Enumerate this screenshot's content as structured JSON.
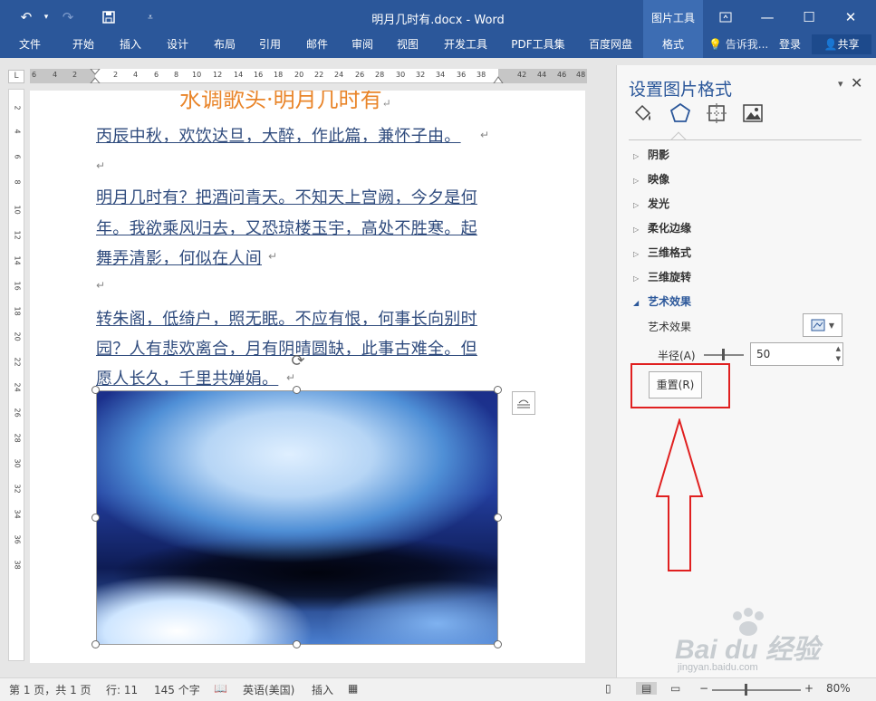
{
  "window": {
    "title": "明月几时有.docx - Word",
    "picture_tools": "图片工具",
    "accent": "#2b579a"
  },
  "ribbon": {
    "tabs": [
      "文件",
      "开始",
      "插入",
      "设计",
      "布局",
      "引用",
      "邮件",
      "审阅",
      "视图",
      "开发工具",
      "PDF工具集",
      "百度网盘",
      "格式"
    ],
    "tellme": "告诉我...",
    "login": "登录",
    "share": "共享"
  },
  "ruler": {
    "corner": "L",
    "h_ticks": [
      "6",
      "4",
      "2",
      "2",
      "4",
      "6",
      "8",
      "10",
      "12",
      "14",
      "16",
      "18",
      "20",
      "22",
      "24",
      "26",
      "28",
      "30",
      "32",
      "34",
      "36",
      "38",
      "42",
      "44",
      "46",
      "48"
    ],
    "v_ticks": [
      "2",
      "4",
      "6",
      "8",
      "10",
      "12",
      "14",
      "16",
      "18",
      "20",
      "22",
      "24",
      "26",
      "28",
      "30",
      "32",
      "34",
      "36",
      "38"
    ]
  },
  "document": {
    "heading": "水调歌头·明月几时有",
    "lines": [
      "丙辰中秋，欢饮达旦，大醉，作此篇，兼怀子由。",
      "明月几时有？把酒问青天。不知天上宫阙，今夕是何",
      "年。我欲乘风归去，又恐琼楼玉宇，高处不胜寒。起",
      "舞弄清影，何似在人间",
      "转朱阁，低绮户，照无眠。不应有恨，何事长向别时",
      "园？人有悲欢离合，月有阴晴圆缺，此事古难全。但",
      "愿人长久，千里共婵娟。"
    ],
    "paragraph_mark": "↵"
  },
  "pane": {
    "title": "设置图片格式",
    "sections": [
      {
        "label": "阴影",
        "expanded": false
      },
      {
        "label": "映像",
        "expanded": false
      },
      {
        "label": "发光",
        "expanded": false
      },
      {
        "label": "柔化边缘",
        "expanded": false
      },
      {
        "label": "三维格式",
        "expanded": false
      },
      {
        "label": "三维旋转",
        "expanded": false
      },
      {
        "label": "艺术效果",
        "expanded": true
      }
    ],
    "art_effect_label": "艺术效果",
    "radius_label": "半径(A)",
    "radius_value": "50",
    "reset_button": "重置(R)",
    "annotation_color": "#e02020"
  },
  "statusbar": {
    "page": "第 1 页，共 1 页",
    "line": "行: 11",
    "words": "145 个字",
    "language": "英语(美国)",
    "mode": "插入",
    "zoom": "80%"
  },
  "watermark": {
    "text": "Bai du 经验",
    "url": "jingyan.baidu.com"
  }
}
